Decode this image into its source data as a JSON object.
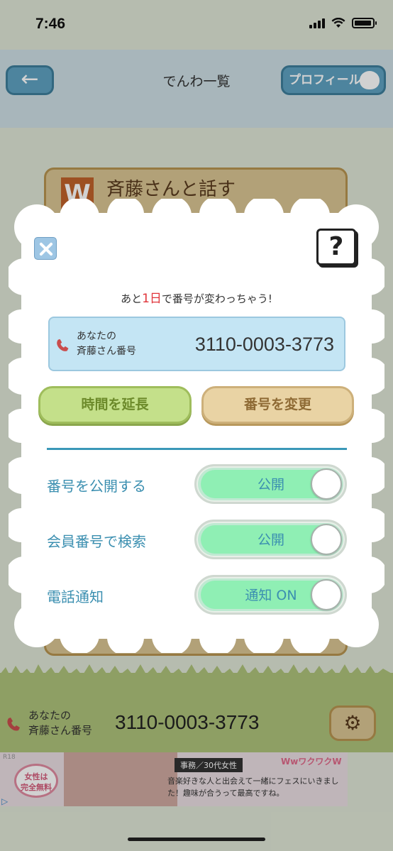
{
  "status_bar": {
    "time": "7:46"
  },
  "nav": {
    "back_label": "←",
    "title": "でんわ一覧",
    "profile_label": "プロフィール"
  },
  "background_card": {
    "badge": "W",
    "title": "斉藤さんと話す"
  },
  "bottom_bar": {
    "label_line1": "あなたの",
    "label_line2": "斉藤さん番号",
    "number": "3110-0003-3773",
    "settings_icon": "gear-icon"
  },
  "ad": {
    "r18": "R18",
    "badge_line1": "女性は",
    "badge_line2": "完全無料",
    "tag": "事務／30代女性",
    "brand": "WwワクワクW",
    "text": "音楽好きな人と出会えて一緒にフェスにいきました！趣味が合うって最高ですね。"
  },
  "modal": {
    "close_icon": "close-icon",
    "help_label": "?",
    "remaining_prefix": "あと",
    "remaining_days": "1日",
    "remaining_suffix": "で番号が変わっちゃう!",
    "number_label_line1": "あなたの",
    "number_label_line2": "斉藤さん番号",
    "number_value": "3110-0003-3773",
    "extend_button": "時間を延長",
    "change_button": "番号を変更",
    "settings": [
      {
        "label": "番号を公開する",
        "toggle_text": "公開",
        "on": true
      },
      {
        "label": "会員番号で検索",
        "toggle_text": "公開",
        "on": true
      },
      {
        "label": "電話通知",
        "toggle_text": "通知 ON",
        "on": true
      }
    ]
  },
  "colors": {
    "accent_blue": "#3b8fb0",
    "toggle_on": "#8fefb4",
    "highlight_red": "#e0343a",
    "extend_green": "#c4e08a",
    "change_tan": "#e9d3a4"
  }
}
